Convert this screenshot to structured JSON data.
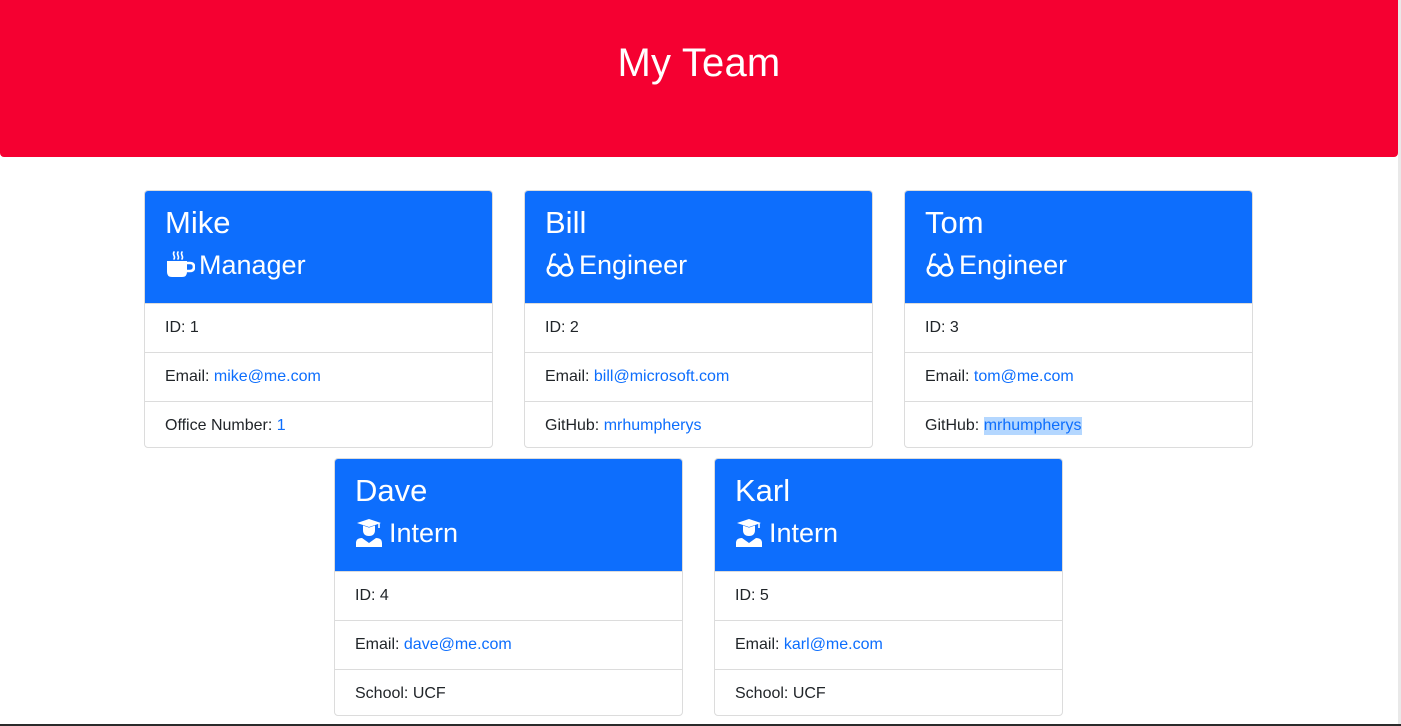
{
  "header": {
    "title": "My Team",
    "background_color": "#f50031"
  },
  "theme": {
    "card_header_color": "#0d6efd",
    "link_color": "#0d6efd"
  },
  "cards": [
    {
      "name": "Mike",
      "role": "Manager",
      "icon": "mug-icon",
      "id_label": "ID: ",
      "id": "1",
      "email_label": "Email: ",
      "email": "mike@me.com",
      "extra_label": "Office Number: ",
      "extra_value": "1"
    },
    {
      "name": "Bill",
      "role": "Engineer",
      "icon": "glasses-icon",
      "id_label": "ID: ",
      "id": "2",
      "email_label": "Email: ",
      "email": "bill@microsoft.com",
      "extra_label": "GitHub: ",
      "extra_value": "mrhumpherys"
    },
    {
      "name": "Tom",
      "role": "Engineer",
      "icon": "glasses-icon",
      "id_label": "ID: ",
      "id": "3",
      "email_label": "Email: ",
      "email": "tom@me.com",
      "extra_label": "GitHub: ",
      "extra_value": "mrhumpherys",
      "extra_selected": true
    },
    {
      "name": "Dave",
      "role": "Intern",
      "icon": "graduate-icon",
      "id_label": "ID: ",
      "id": "4",
      "email_label": "Email: ",
      "email": "dave@me.com",
      "extra_label": "School: ",
      "extra_value": "UCF"
    },
    {
      "name": "Karl",
      "role": "Intern",
      "icon": "graduate-icon",
      "id_label": "ID: ",
      "id": "5",
      "email_label": "Email: ",
      "email": "karl@me.com",
      "extra_label": "School: ",
      "extra_value": "UCF"
    }
  ]
}
